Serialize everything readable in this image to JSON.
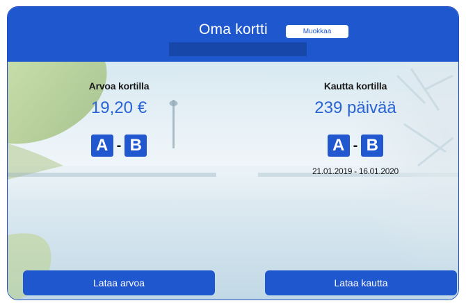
{
  "header": {
    "title": "Oma kortti",
    "edit_label": "Muokkaa"
  },
  "value_panel": {
    "label": "Arvoa kortilla",
    "amount": "19,20 €",
    "zone_from": "A",
    "zone_sep": "-",
    "zone_to": "B"
  },
  "period_panel": {
    "label": "Kautta kortilla",
    "days": "239 päivää",
    "zone_from": "A",
    "zone_sep": "-",
    "zone_to": "B",
    "dates": "21.01.2019 - 16.01.2020"
  },
  "actions": {
    "load_value": "Lataa arvoa",
    "load_period": "Lataa kautta"
  },
  "colors": {
    "primary": "#1f57cf",
    "value_text": "#2a63d4"
  },
  "icons": {
    "background": "landscape-image"
  }
}
